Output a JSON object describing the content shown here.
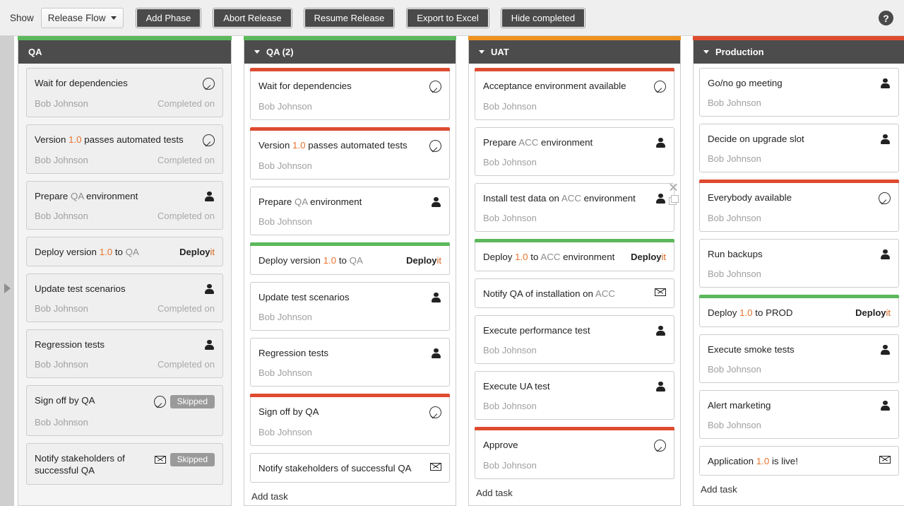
{
  "toolbar": {
    "show_label": "Show",
    "select_value": "Release Flow",
    "buttons": [
      {
        "label": "Add Phase",
        "name": "add-phase-button"
      },
      {
        "label": "Abort Release",
        "name": "abort-release-button"
      },
      {
        "label": "Resume Release",
        "name": "resume-release-button"
      },
      {
        "label": "Export to Excel",
        "name": "export-to-excel-button"
      },
      {
        "label": "Hide completed",
        "name": "hide-completed-button"
      }
    ],
    "help_glyph": "?"
  },
  "colors": {
    "green": "#5cb85c",
    "orange": "#f0921e",
    "red": "#de4b30",
    "header_bg": "#4c4c4c",
    "accent_text": "#e8732c",
    "skipped_badge": "#9a9a9a"
  },
  "add_task_label": "Add task",
  "completed_label": "Completed on",
  "assignee_name": "Bob Johnson",
  "deployit": {
    "bold": "Deploy",
    "rest": "it"
  },
  "skipped_label": "Skipped",
  "columns": [
    {
      "title": "QA",
      "bar_color": "green",
      "has_caret": false,
      "card_style": "gray",
      "show_completed": true,
      "show_add_task": false,
      "cards": [
        {
          "title_parts": [
            {
              "t": "Wait for dependencies",
              "s": "normal"
            }
          ],
          "icon": "check-circle-icon",
          "assignee": "Bob Johnson",
          "completed": "Completed on",
          "top_color": "none"
        },
        {
          "title_parts": [
            {
              "t": "Version ",
              "s": "normal"
            },
            {
              "t": "1.0",
              "s": "accent"
            },
            {
              "t": " passes automated tests",
              "s": "normal"
            }
          ],
          "icon": "check-circle-icon",
          "assignee": "Bob Johnson",
          "completed": "Completed on",
          "top_color": "none"
        },
        {
          "title_parts": [
            {
              "t": "Prepare ",
              "s": "normal"
            },
            {
              "t": "QA",
              "s": "muted"
            },
            {
              "t": " environment",
              "s": "normal"
            }
          ],
          "icon": "person-icon",
          "assignee": "Bob Johnson",
          "completed": "Completed on",
          "top_color": "none"
        },
        {
          "title_parts": [
            {
              "t": "Deploy version ",
              "s": "normal"
            },
            {
              "t": "1.0",
              "s": "accent"
            },
            {
              "t": " to ",
              "s": "normal"
            },
            {
              "t": "QA",
              "s": "muted"
            }
          ],
          "icon": "deployit-logo",
          "assignee": "",
          "completed": "",
          "top_color": "none"
        },
        {
          "title_parts": [
            {
              "t": "Update test scenarios",
              "s": "normal"
            }
          ],
          "icon": "person-icon",
          "assignee": "Bob Johnson",
          "completed": "Completed on",
          "top_color": "none"
        },
        {
          "title_parts": [
            {
              "t": "Regression tests",
              "s": "normal"
            }
          ],
          "icon": "person-icon",
          "assignee": "Bob Johnson",
          "completed": "Completed on",
          "top_color": "none"
        },
        {
          "title_parts": [
            {
              "t": "Sign off by QA",
              "s": "normal"
            }
          ],
          "icon": "check-circle-icon",
          "badge": "Skipped",
          "assignee": "Bob Johnson",
          "completed": "",
          "top_color": "none"
        },
        {
          "title_parts": [
            {
              "t": "Notify stakeholders of successful QA",
              "s": "normal"
            }
          ],
          "icon": "mail-icon",
          "badge": "Skipped",
          "assignee": "",
          "completed": "",
          "top_color": "none"
        }
      ]
    },
    {
      "title": "QA (2)",
      "bar_color": "green",
      "has_caret": true,
      "card_style": "white",
      "show_completed": false,
      "show_add_task": true,
      "cards": [
        {
          "title_parts": [
            {
              "t": "Wait for dependencies",
              "s": "normal"
            }
          ],
          "icon": "check-circle-icon",
          "assignee": "Bob Johnson",
          "completed": "",
          "top_color": "red"
        },
        {
          "title_parts": [
            {
              "t": "Version ",
              "s": "normal"
            },
            {
              "t": "1.0",
              "s": "accent"
            },
            {
              "t": " passes automated tests",
              "s": "normal"
            }
          ],
          "icon": "check-circle-icon",
          "assignee": "Bob Johnson",
          "completed": "",
          "top_color": "red"
        },
        {
          "title_parts": [
            {
              "t": "Prepare ",
              "s": "normal"
            },
            {
              "t": "QA",
              "s": "muted"
            },
            {
              "t": " environment",
              "s": "normal"
            }
          ],
          "icon": "person-icon",
          "assignee": "Bob Johnson",
          "completed": "",
          "top_color": "none"
        },
        {
          "title_parts": [
            {
              "t": "Deploy version ",
              "s": "normal"
            },
            {
              "t": "1.0",
              "s": "accent"
            },
            {
              "t": " to ",
              "s": "normal"
            },
            {
              "t": "QA",
              "s": "muted"
            }
          ],
          "icon": "deployit-logo",
          "assignee": "",
          "completed": "",
          "top_color": "green"
        },
        {
          "title_parts": [
            {
              "t": "Update test scenarios",
              "s": "normal"
            }
          ],
          "icon": "person-icon",
          "assignee": "Bob Johnson",
          "completed": "",
          "top_color": "none"
        },
        {
          "title_parts": [
            {
              "t": "Regression tests",
              "s": "normal"
            }
          ],
          "icon": "person-icon",
          "assignee": "Bob Johnson",
          "completed": "",
          "top_color": "none"
        },
        {
          "title_parts": [
            {
              "t": "Sign off by QA",
              "s": "normal"
            }
          ],
          "icon": "check-circle-icon",
          "assignee": "Bob Johnson",
          "completed": "",
          "top_color": "red"
        },
        {
          "title_parts": [
            {
              "t": "Notify stakeholders of successful QA",
              "s": "normal"
            }
          ],
          "icon": "mail-icon",
          "assignee": "",
          "completed": "",
          "top_color": "none"
        }
      ]
    },
    {
      "title": "UAT",
      "bar_color": "orange",
      "has_caret": true,
      "card_style": "white",
      "show_completed": false,
      "show_add_task": true,
      "cards": [
        {
          "title_parts": [
            {
              "t": "Acceptance environment available",
              "s": "normal"
            }
          ],
          "icon": "check-circle-icon",
          "assignee": "Bob Johnson",
          "completed": "",
          "top_color": "red"
        },
        {
          "title_parts": [
            {
              "t": "Prepare ",
              "s": "normal"
            },
            {
              "t": "ACC",
              "s": "muted"
            },
            {
              "t": " environment",
              "s": "normal"
            }
          ],
          "icon": "person-icon",
          "assignee": "Bob Johnson",
          "completed": "",
          "top_color": "none"
        },
        {
          "title_parts": [
            {
              "t": "Install test data on ",
              "s": "normal"
            },
            {
              "t": "ACC",
              "s": "muted"
            },
            {
              "t": " environment",
              "s": "normal"
            }
          ],
          "icon": "person-icon",
          "assignee": "Bob Johnson",
          "completed": "",
          "top_color": "none",
          "hovered": true
        },
        {
          "title_parts": [
            {
              "t": "Deploy ",
              "s": "normal"
            },
            {
              "t": "1.0",
              "s": "accent"
            },
            {
              "t": " to ",
              "s": "normal"
            },
            {
              "t": "ACC",
              "s": "muted"
            },
            {
              "t": " environment",
              "s": "normal"
            }
          ],
          "icon": "deployit-logo",
          "assignee": "",
          "completed": "",
          "top_color": "green"
        },
        {
          "title_parts": [
            {
              "t": "Notify QA of installation on ",
              "s": "normal"
            },
            {
              "t": "ACC",
              "s": "muted"
            }
          ],
          "icon": "mail-icon",
          "assignee": "",
          "completed": "",
          "top_color": "none"
        },
        {
          "title_parts": [
            {
              "t": "Execute performance test",
              "s": "normal"
            }
          ],
          "icon": "person-icon",
          "assignee": "Bob Johnson",
          "completed": "",
          "top_color": "none"
        },
        {
          "title_parts": [
            {
              "t": "Execute UA test",
              "s": "normal"
            }
          ],
          "icon": "person-icon",
          "assignee": "Bob Johnson",
          "completed": "",
          "top_color": "none"
        },
        {
          "title_parts": [
            {
              "t": "Approve",
              "s": "normal"
            }
          ],
          "icon": "check-circle-icon",
          "assignee": "Bob Johnson",
          "completed": "",
          "top_color": "red"
        }
      ]
    },
    {
      "title": "Production",
      "bar_color": "red",
      "has_caret": true,
      "card_style": "white",
      "show_completed": false,
      "show_add_task": true,
      "cards": [
        {
          "title_parts": [
            {
              "t": "Go/no go meeting",
              "s": "normal"
            }
          ],
          "icon": "person-icon",
          "assignee": "Bob Johnson",
          "completed": "",
          "top_color": "none"
        },
        {
          "title_parts": [
            {
              "t": "Decide on upgrade slot",
              "s": "normal"
            }
          ],
          "icon": "person-icon",
          "assignee": "Bob Johnson",
          "completed": "",
          "top_color": "none"
        },
        {
          "title_parts": [
            {
              "t": "Everybody available",
              "s": "normal"
            }
          ],
          "icon": "check-circle-icon",
          "assignee": "Bob Johnson",
          "completed": "",
          "top_color": "red"
        },
        {
          "title_parts": [
            {
              "t": "Run backups",
              "s": "normal"
            }
          ],
          "icon": "person-icon",
          "assignee": "Bob Johnson",
          "completed": "",
          "top_color": "none"
        },
        {
          "title_parts": [
            {
              "t": "Deploy ",
              "s": "normal"
            },
            {
              "t": "1.0",
              "s": "accent"
            },
            {
              "t": " to PROD",
              "s": "normal"
            }
          ],
          "icon": "deployit-logo",
          "assignee": "",
          "completed": "",
          "top_color": "green"
        },
        {
          "title_parts": [
            {
              "t": "Execute smoke tests",
              "s": "normal"
            }
          ],
          "icon": "person-icon",
          "assignee": "Bob Johnson",
          "completed": "",
          "top_color": "none"
        },
        {
          "title_parts": [
            {
              "t": "Alert marketing",
              "s": "normal"
            }
          ],
          "icon": "person-icon",
          "assignee": "Bob Johnson",
          "completed": "",
          "top_color": "none"
        },
        {
          "title_parts": [
            {
              "t": "Application ",
              "s": "normal"
            },
            {
              "t": "1.0",
              "s": "accent"
            },
            {
              "t": " is live!",
              "s": "normal"
            }
          ],
          "icon": "mail-icon",
          "assignee": "",
          "completed": "",
          "top_color": "none"
        }
      ]
    }
  ]
}
